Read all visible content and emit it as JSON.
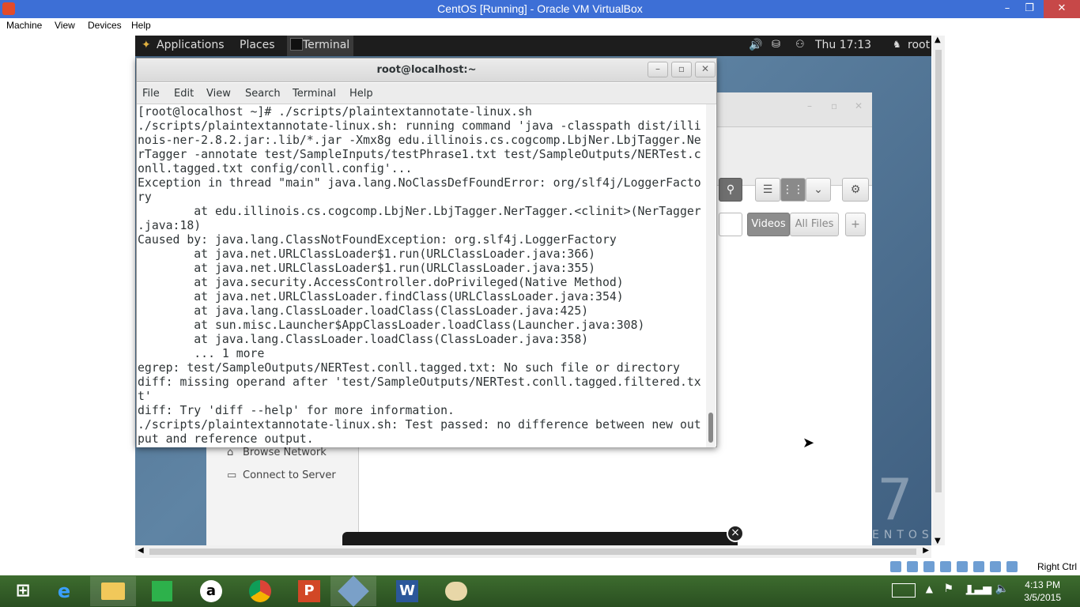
{
  "host_window": {
    "title": "CentOS [Running] - Oracle VM VirtualBox",
    "minimize_glyph": "–",
    "maximize_glyph": "❐",
    "close_glyph": "✕"
  },
  "vb_menu": {
    "items": [
      "Machine",
      "View",
      "Devices",
      "Help"
    ]
  },
  "gnome_panel": {
    "applications": "Applications",
    "places": "Places",
    "terminal_task": "Terminal",
    "clock": "Thu 17:13",
    "user": "root"
  },
  "nautilus": {
    "sidebar_items": [
      "Browse Network",
      "Connect to Server"
    ],
    "search_chips": [
      "Videos",
      "All Files"
    ],
    "add_glyph": "+"
  },
  "terminal": {
    "title": "root@localhost:~",
    "menu": [
      "File",
      "Edit",
      "View",
      "Search",
      "Terminal",
      "Help"
    ],
    "lines": [
      "[root@localhost ~]# ./scripts/plaintextannotate-linux.sh",
      "./scripts/plaintextannotate-linux.sh: running command 'java -classpath dist/illi",
      "nois-ner-2.8.2.jar:.lib/*.jar -Xmx8g edu.illinois.cs.cogcomp.LbjNer.LbjTagger.Ne",
      "rTagger -annotate test/SampleInputs/testPhrase1.txt test/SampleOutputs/NERTest.c",
      "onll.tagged.txt config/conll.config'...",
      "Exception in thread \"main\" java.lang.NoClassDefFoundError: org/slf4j/LoggerFacto",
      "ry",
      "        at edu.illinois.cs.cogcomp.LbjNer.LbjTagger.NerTagger.<clinit>(NerTagger",
      ".java:18)",
      "Caused by: java.lang.ClassNotFoundException: org.slf4j.LoggerFactory",
      "        at java.net.URLClassLoader$1.run(URLClassLoader.java:366)",
      "        at java.net.URLClassLoader$1.run(URLClassLoader.java:355)",
      "        at java.security.AccessController.doPrivileged(Native Method)",
      "        at java.net.URLClassLoader.findClass(URLClassLoader.java:354)",
      "        at java.lang.ClassLoader.loadClass(ClassLoader.java:425)",
      "        at sun.misc.Launcher$AppClassLoader.loadClass(Launcher.java:308)",
      "        at java.lang.ClassLoader.loadClass(ClassLoader.java:358)",
      "        ... 1 more",
      "egrep: test/SampleOutputs/NERTest.conll.tagged.txt: No such file or directory",
      "diff: missing operand after 'test/SampleOutputs/NERTest.conll.tagged.filtered.tx",
      "t'",
      "diff: Try 'diff --help' for more information.",
      "./scripts/plaintextannotate-linux.sh: Test passed: no difference between new out",
      "put and reference output."
    ]
  },
  "status_bar": {
    "host_key": "Right Ctrl"
  },
  "taskbar": {
    "time": "4:13 PM",
    "date": "3/5/2015"
  },
  "colors": {
    "host_titlebar": "#3d6fd6",
    "taskbar": "#3d6c2e",
    "terminal_text": "#2e3436"
  }
}
